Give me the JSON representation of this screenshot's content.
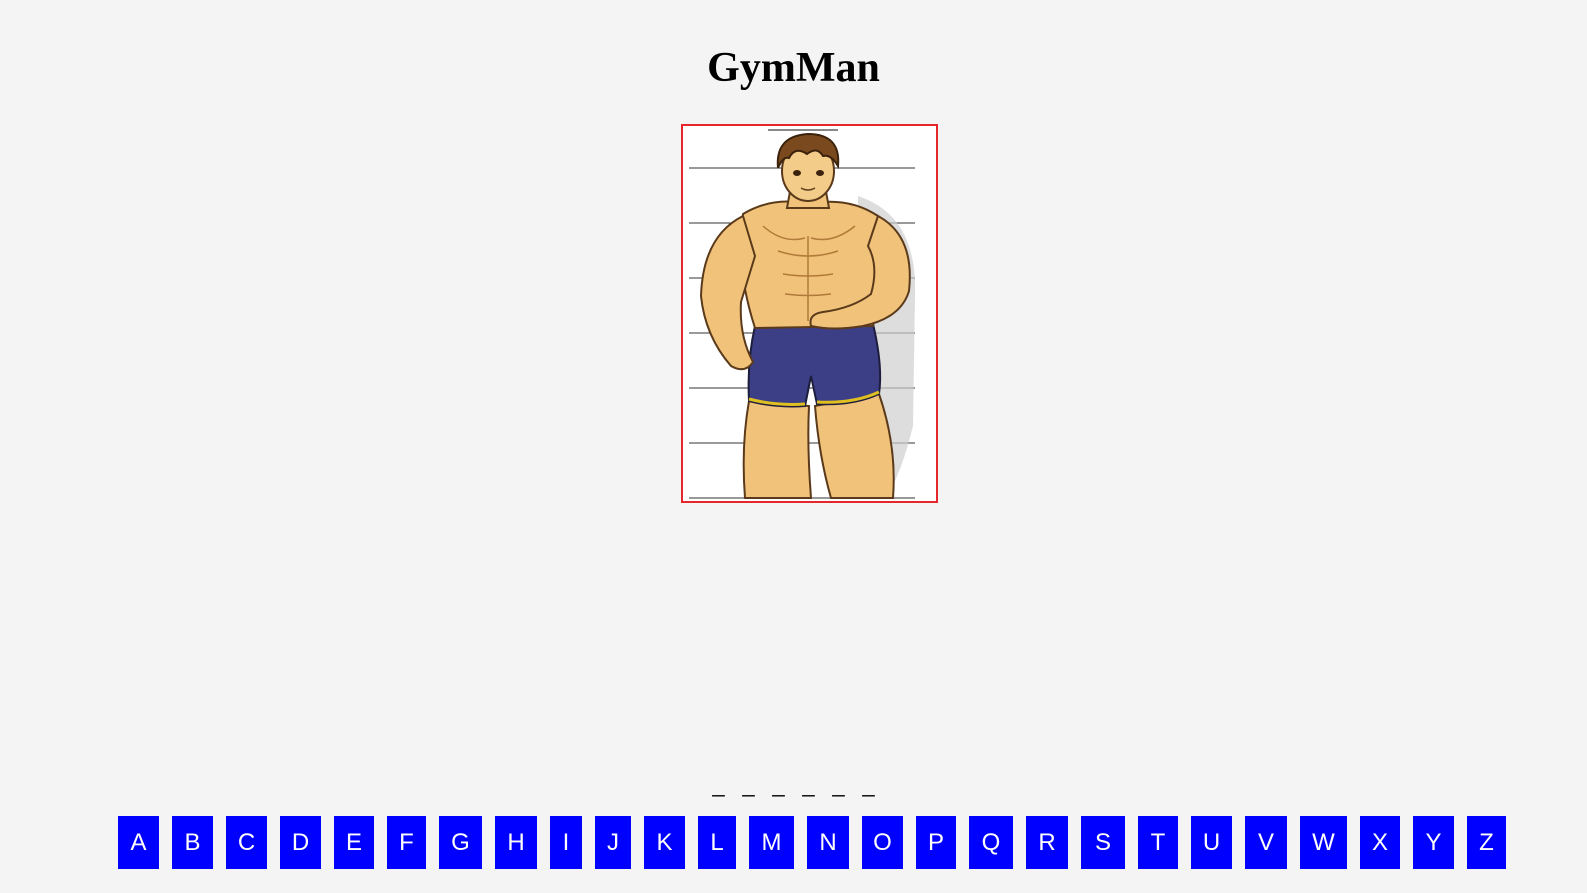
{
  "game": {
    "title": "GymMan",
    "word_slots": [
      "_",
      "_",
      "_",
      "_",
      "_",
      "_"
    ]
  },
  "keyboard": {
    "letters": [
      "A",
      "B",
      "C",
      "D",
      "E",
      "F",
      "G",
      "H",
      "I",
      "J",
      "K",
      "L",
      "M",
      "N",
      "O",
      "P",
      "Q",
      "R",
      "S",
      "T",
      "U",
      "V",
      "W",
      "X",
      "Y",
      "Z"
    ],
    "key_color": "#0000ff",
    "key_text_color": "#ffffff"
  },
  "picture": {
    "frame_color": "#e5262b",
    "subject": "muscular-man-illustration"
  }
}
